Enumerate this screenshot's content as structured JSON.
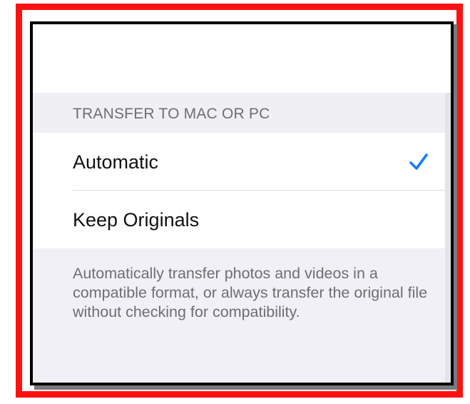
{
  "section": {
    "header": "TRANSFER TO MAC OR PC"
  },
  "options": [
    {
      "label": "Automatic",
      "selected": true
    },
    {
      "label": "Keep Originals",
      "selected": false
    }
  ],
  "footer": {
    "description": "Automatically transfer photos and videos in a compatible format, or always transfer the original file without checking for compatibility."
  },
  "icons": {
    "selected_indicator": "checkmark-icon"
  },
  "colors": {
    "accent": "#147efb",
    "highlight_border": "#ff1111",
    "group_background": "#efeff4",
    "secondary_text": "#6e6e73"
  }
}
